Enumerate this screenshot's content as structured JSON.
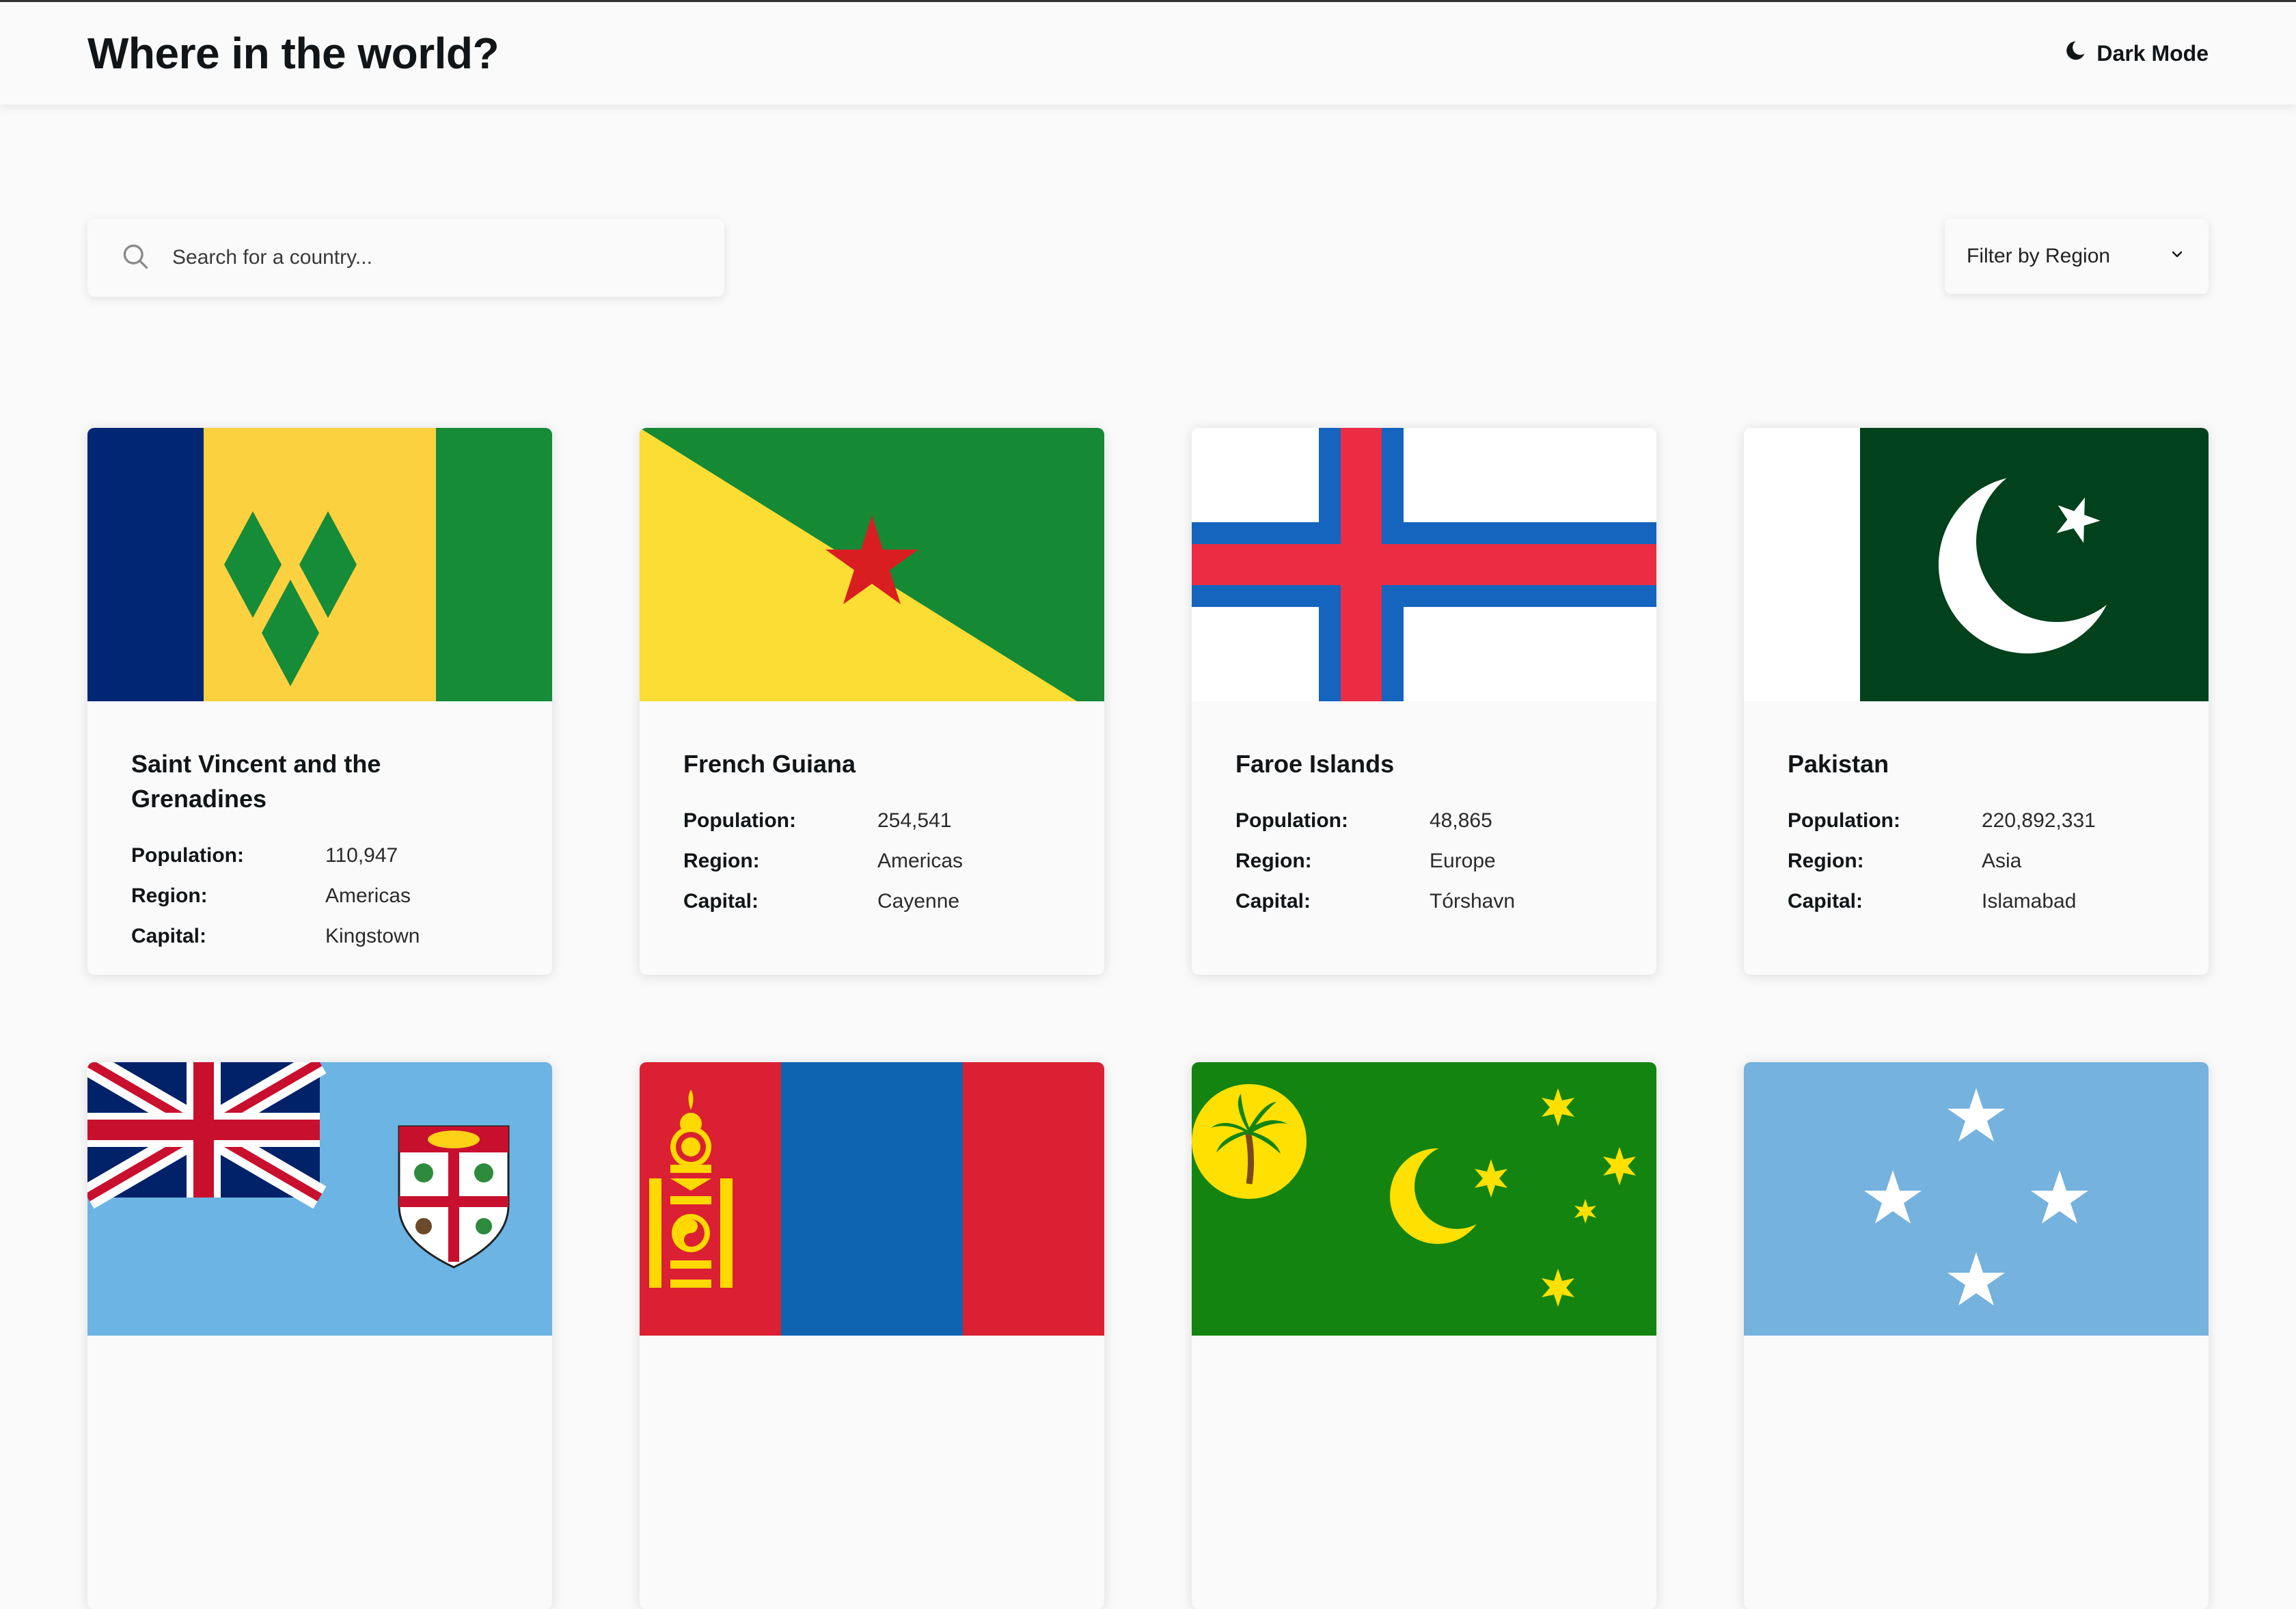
{
  "header": {
    "title": "Where in the world?",
    "dark_mode_label": "Dark Mode"
  },
  "search": {
    "placeholder": "Search for a country..."
  },
  "filter": {
    "label": "Filter by Region"
  },
  "labels": {
    "population": "Population:",
    "region": "Region:",
    "capital": "Capital:"
  },
  "countries": [
    {
      "name": "Saint Vincent and the Grenadines",
      "population": "110,947",
      "region": "Americas",
      "capital": "Kingstown"
    },
    {
      "name": "French Guiana",
      "population": "254,541",
      "region": "Americas",
      "capital": "Cayenne"
    },
    {
      "name": "Faroe Islands",
      "population": "48,865",
      "region": "Europe",
      "capital": "Tórshavn"
    },
    {
      "name": "Pakistan",
      "population": "220,892,331",
      "region": "Asia",
      "capital": "Islamabad"
    }
  ],
  "flags_row2": [
    "fiji-flag",
    "mongolia-flag",
    "cocos-islands-flag",
    "micronesia-flag"
  ],
  "colors": {
    "background": "#fafafa",
    "text": "#111517"
  }
}
